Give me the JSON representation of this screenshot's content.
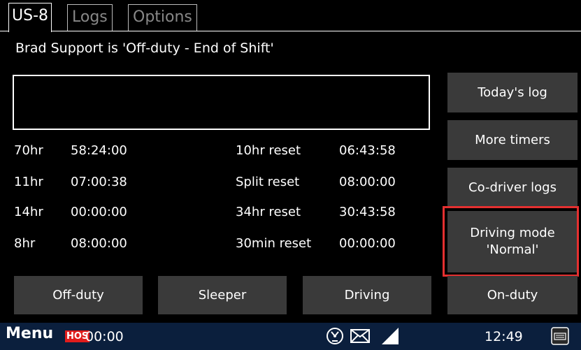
{
  "tabs": [
    {
      "label": "US-8",
      "active": true
    },
    {
      "label": "Logs",
      "active": false
    },
    {
      "label": "Options",
      "active": false
    }
  ],
  "status_text": "Brad Support is 'Off-duty - End of Shift'",
  "message_box": "",
  "timers": [
    {
      "label": "70hr",
      "value": "58:24:00",
      "reset_label": "10hr reset",
      "reset_value": "06:43:58"
    },
    {
      "label": "11hr",
      "value": "07:00:38",
      "reset_label": "Split reset",
      "reset_value": "08:00:00"
    },
    {
      "label": "14hr",
      "value": "00:00:00",
      "reset_label": "34hr reset",
      "reset_value": "30:43:58"
    },
    {
      "label": "8hr",
      "value": "08:00:00",
      "reset_label": "30min reset",
      "reset_value": "00:00:00"
    }
  ],
  "side_buttons": {
    "todays_log": "Today's log",
    "more_timers": "More timers",
    "co_driver_logs": "Co-driver logs",
    "driving_mode_line1": "Driving mode",
    "driving_mode_line2": "'Normal'"
  },
  "duty_buttons": {
    "off_duty": "Off-duty",
    "sleeper": "Sleeper",
    "driving": "Driving",
    "on_duty": "On-duty"
  },
  "bottom_bar": {
    "menu": "Menu",
    "hos_badge": "HOS",
    "hos_time": "00:00",
    "clock": "12:49",
    "icons": [
      "speedometer-icon",
      "mail-icon",
      "signal-icon",
      "keyboard-icon"
    ]
  },
  "colors": {
    "background": "#000000",
    "button": "#3a3a3a",
    "highlight": "#e53030",
    "bottom_bar": "#0b1f3d",
    "hos_badge": "#e01c1c"
  }
}
